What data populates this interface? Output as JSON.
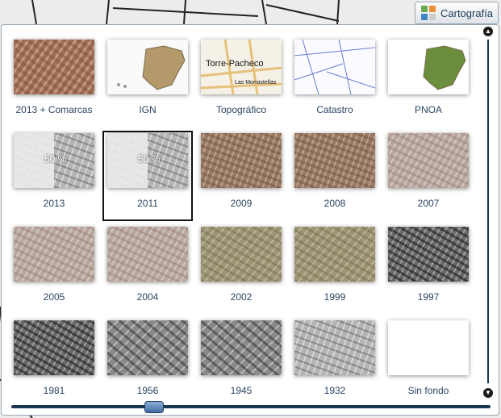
{
  "toolbar": {
    "cartografia_label": "Cartografía",
    "icon_colors": [
      "#6aa84f",
      "#e69138",
      "#3d85c6",
      "#cccccc"
    ]
  },
  "basemaps": [
    {
      "label": "2013 + Comarcas",
      "style": "t-urban",
      "overlay": "",
      "selected": false
    },
    {
      "label": "IGN",
      "style": "t-ign",
      "overlay": "",
      "selected": false
    },
    {
      "label": "Topográfico",
      "style": "t-topo",
      "overlay": "",
      "text_main": "Torre-Pacheco",
      "text_sub": "Las Morrastellas",
      "selected": false
    },
    {
      "label": "Catastro",
      "style": "t-catastro",
      "overlay": "",
      "selected": false
    },
    {
      "label": "PNOA",
      "style": "t-pnoa",
      "overlay": "",
      "selected": false
    },
    {
      "label": "2013",
      "style": "t-bw-light",
      "overlay": "50 %",
      "selected": false
    },
    {
      "label": "2011",
      "style": "t-bw-light",
      "overlay": "50 %",
      "selected": true
    },
    {
      "label": "2009",
      "style": "t-aerial-warm",
      "overlay": "",
      "selected": false
    },
    {
      "label": "2008",
      "style": "t-aerial-warm",
      "overlay": "",
      "selected": false
    },
    {
      "label": "2007",
      "style": "t-aerial-pale",
      "overlay": "",
      "selected": false
    },
    {
      "label": "2005",
      "style": "t-aerial-pale",
      "overlay": "",
      "selected": false
    },
    {
      "label": "2004",
      "style": "t-aerial-pale",
      "overlay": "",
      "selected": false
    },
    {
      "label": "2002",
      "style": "t-aerial-olive",
      "overlay": "",
      "selected": false
    },
    {
      "label": "1999",
      "style": "t-aerial-olive",
      "overlay": "",
      "selected": false
    },
    {
      "label": "1997",
      "style": "t-bw-dark",
      "overlay": "",
      "selected": false
    },
    {
      "label": "1981",
      "style": "t-bw-dark",
      "overlay": "",
      "selected": false
    },
    {
      "label": "1956",
      "style": "t-bw-mid",
      "overlay": "",
      "selected": false
    },
    {
      "label": "1945",
      "style": "t-bw-mid",
      "overlay": "",
      "selected": false
    },
    {
      "label": "1932",
      "style": "t-bw-light",
      "overlay": "",
      "selected": false
    },
    {
      "label": "Sin fondo",
      "style": "t-white",
      "overlay": "",
      "selected": false
    }
  ]
}
